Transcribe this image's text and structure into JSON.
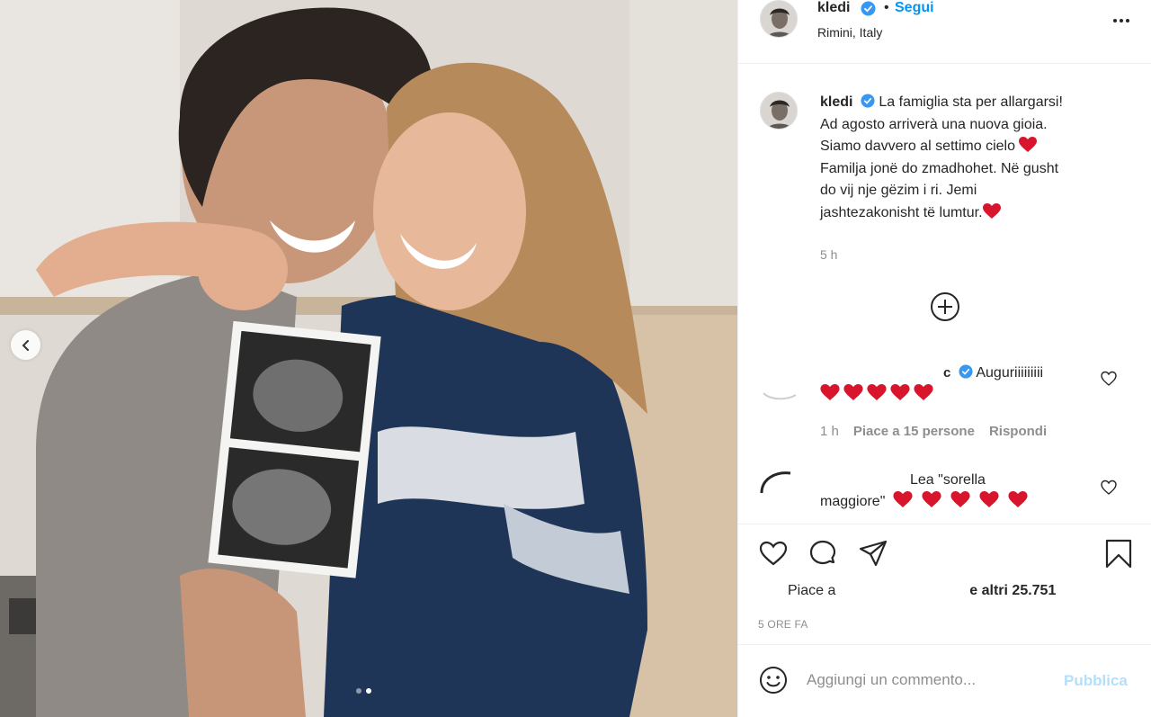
{
  "post": {
    "username": "kledi",
    "follow_sep": "•",
    "follow_label": "Segui",
    "location": "Rimini, Italy",
    "caption_lines": [
      "La famiglia sta per allargarsi!",
      "Ad agosto arriverà una nuova gioia.",
      "Siamo davvero al settimo cielo",
      "Familja jonë do zmadhohet. Në gusht",
      "do vij nje gëzim i ri. Jemi",
      "jashtezakonisht të lumtur."
    ],
    "caption_time": "5 h"
  },
  "comments": [
    {
      "username_visible": "c",
      "text": "Auguriiiiiiiii",
      "hearts": 5,
      "time": "1 h",
      "likes": "Piace a 15 persone",
      "reply": "Rispondi"
    },
    {
      "text_line1": "Lea \"sorella",
      "text_line2": "maggiore\"",
      "hearts": 5
    }
  ],
  "likes": {
    "prefix": "Piace a",
    "suffix": "e altri 25.751"
  },
  "time_ago": "5 ORE FA",
  "comment_input": {
    "placeholder": "Aggiungi un commento...",
    "submit_label": "Pubblica"
  },
  "colors": {
    "accent": "#0095f6",
    "verified": "#3897f0",
    "heart": "#e0245e",
    "publish_disabled": "#b2dffc"
  },
  "carousel": {
    "slides": 2,
    "active_index": 1
  },
  "icons": [
    "chevron-left-icon",
    "verified-icon",
    "more-icon",
    "plus-circle-icon",
    "heart-icon",
    "comment-icon",
    "share-icon",
    "bookmark-icon",
    "emoji-icon"
  ]
}
